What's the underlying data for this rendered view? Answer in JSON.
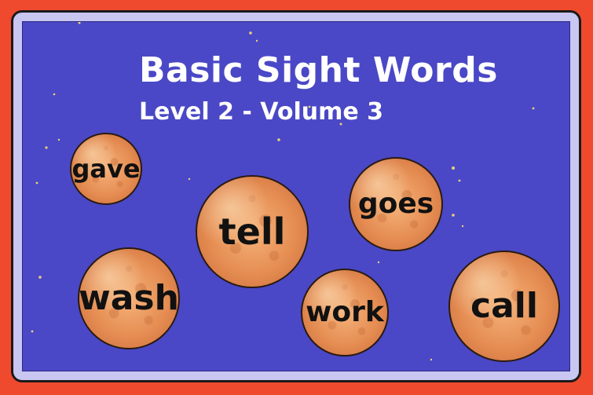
{
  "title": "Basic Sight Words",
  "subtitle": "Level 2 - Volume 3",
  "words": [
    "gave",
    "tell",
    "goes",
    "wash",
    "work",
    "call"
  ],
  "colors": {
    "outer_border": "#f04a2e",
    "frame": "#c9c6f2",
    "board": "#4a48c6",
    "planet": "#e58d52",
    "text": "#ffffff"
  }
}
